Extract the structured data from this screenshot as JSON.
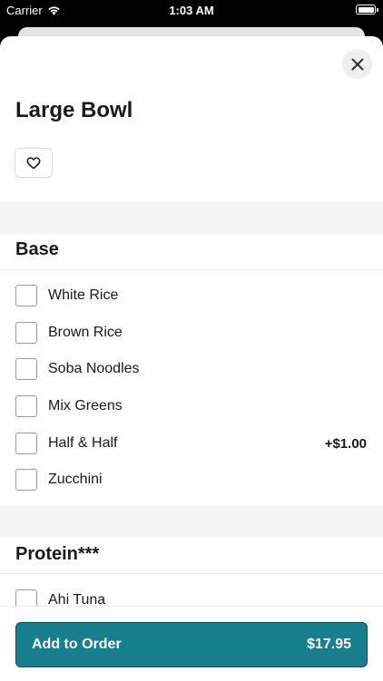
{
  "status_bar": {
    "carrier": "Carrier",
    "time": "1:03 AM",
    "wifi_icon": "wifi-icon",
    "battery_icon": "battery-icon"
  },
  "sheet": {
    "title": "Large Bowl",
    "close_icon": "close-icon",
    "favorite_icon": "heart-icon"
  },
  "sections": [
    {
      "title": "Base",
      "options": [
        {
          "label": "White Rice",
          "price": ""
        },
        {
          "label": "Brown Rice",
          "price": ""
        },
        {
          "label": "Soba Noodles",
          "price": ""
        },
        {
          "label": "Mix Greens",
          "price": ""
        },
        {
          "label": "Half & Half",
          "price": "+$1.00"
        },
        {
          "label": "Zucchini",
          "price": ""
        }
      ]
    },
    {
      "title": "Protein***",
      "options": [
        {
          "label": "Ahi Tuna",
          "price": ""
        }
      ]
    }
  ],
  "footer": {
    "add_label": "Add to Order",
    "total": "$17.95"
  },
  "colors": {
    "accent": "#177f8e",
    "accent_border": "#0d4e57",
    "section_band": "#f5f5f5"
  }
}
